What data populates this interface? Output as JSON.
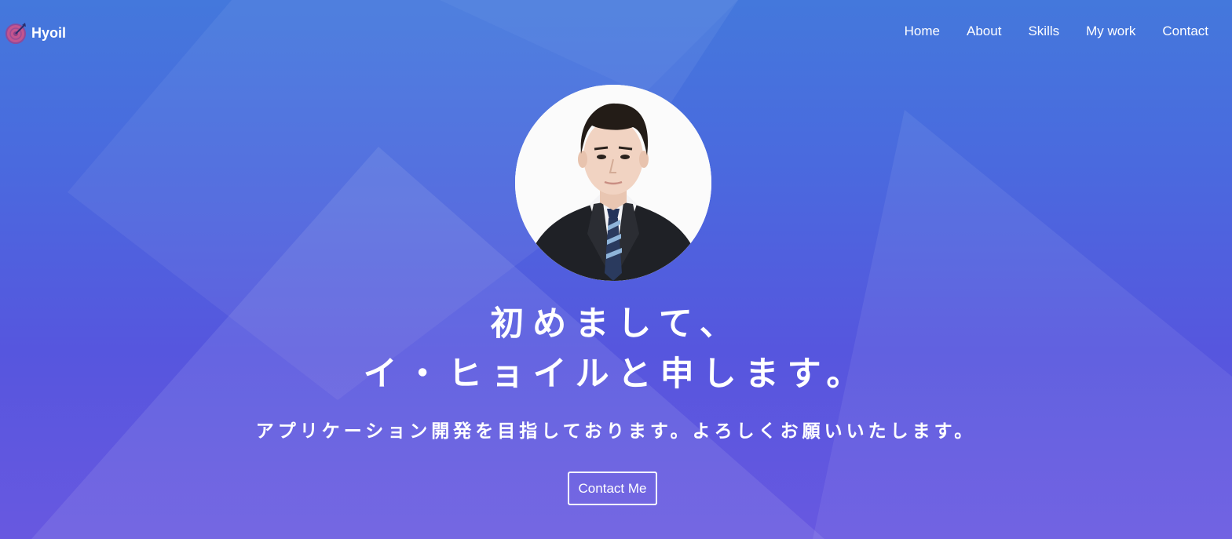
{
  "brand": {
    "name": "Hyoil",
    "icon": "target-logo-icon"
  },
  "nav": {
    "items": [
      {
        "label": "Home"
      },
      {
        "label": "About"
      },
      {
        "label": "Skills"
      },
      {
        "label": "My work"
      },
      {
        "label": "Contact"
      }
    ]
  },
  "hero": {
    "greeting_line1": "初めまして、",
    "greeting_line2": "イ・ヒョイルと申します。",
    "subtitle": "アプリケーション開発を目指しております。よろしくお願いいたします。",
    "cta_label": "Contact Me"
  },
  "colors": {
    "gradient_top": "#4478dc",
    "gradient_bottom": "#6858e0",
    "text": "#ffffff"
  }
}
